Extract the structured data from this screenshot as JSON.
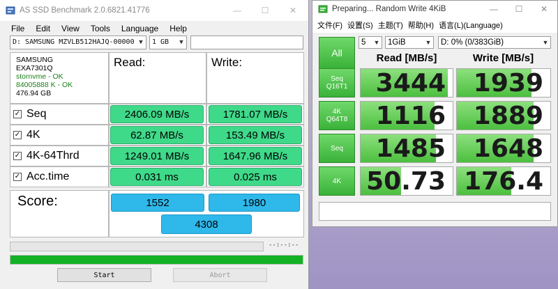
{
  "asssd": {
    "title": "AS SSD Benchmark 2.0.6821.41776",
    "menu": [
      "File",
      "Edit",
      "View",
      "Tools",
      "Language",
      "Help"
    ],
    "drive_select": "D: SAMSUNG MZVLB512HAJQ-00000",
    "size_select": "1 GB",
    "drive_info": {
      "vendor": "SAMSUNG",
      "model": "EXA7301Q",
      "driver": "stornvme - OK",
      "alignment": "84005888 K - OK",
      "capacity": "476.94 GB"
    },
    "read_header": "Read:",
    "write_header": "Write:",
    "rows": [
      {
        "label": "Seq",
        "read": "2406.09 MB/s",
        "write": "1781.07 MB/s"
      },
      {
        "label": "4K",
        "read": "62.87 MB/s",
        "write": "153.49 MB/s"
      },
      {
        "label": "4K-64Thrd",
        "read": "1249.01 MB/s",
        "write": "1647.96 MB/s"
      },
      {
        "label": "Acc.time",
        "read": "0.031 ms",
        "write": "0.025 ms"
      }
    ],
    "score_label": "Score:",
    "score_read": "1552",
    "score_write": "1980",
    "score_total": "4308",
    "time_display": "--:--:--",
    "overall_progress": 1.0,
    "start_label": "Start",
    "abort_label": "Abort",
    "colors": {
      "result": "#3fd98a",
      "score": "#2fb8ea",
      "progress": "#13b224"
    }
  },
  "cdm": {
    "title": "Preparing... Random Write 4KiB",
    "menu": [
      "文件(F)",
      "设置(S)",
      "主题(T)",
      "帮助(H)",
      "语言(L)(Language)"
    ],
    "all_label": "All",
    "count_select": "5",
    "size_select": "1GiB",
    "drive_select": "D: 0% (0/383GiB)",
    "read_header": "Read [MB/s]",
    "write_header": "Write [MB/s]",
    "tests": [
      {
        "line1": "Seq",
        "line2": "Q16T1",
        "read": "3444",
        "write": "1939",
        "read_fill": 0.95,
        "write_fill": 0.8
      },
      {
        "line1": "4K",
        "line2": "Q64T8",
        "read": "1116",
        "write": "1889",
        "read_fill": 0.8,
        "write_fill": 0.82
      },
      {
        "line1": "Seq",
        "line2": "",
        "read": "1485",
        "write": "1648",
        "read_fill": 0.82,
        "write_fill": 0.82
      },
      {
        "line1": "4K",
        "line2": "",
        "read": "50.73",
        "write": "176.4",
        "read_fill": 0.44,
        "write_fill": 0.58
      }
    ],
    "colors": {
      "button": "#3ab239",
      "bar": "#4cbf3f"
    }
  }
}
